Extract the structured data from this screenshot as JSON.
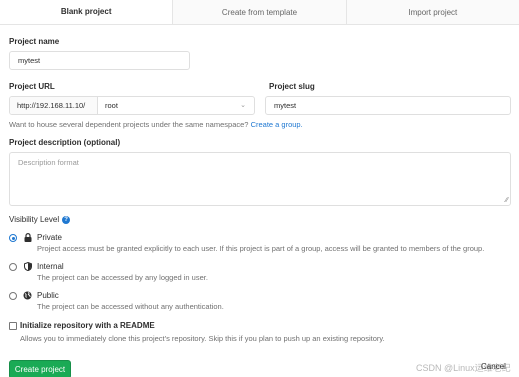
{
  "tabs": [
    {
      "label": "Blank project",
      "active": true
    },
    {
      "label": "Create from template",
      "active": false
    },
    {
      "label": "Import project",
      "active": false
    }
  ],
  "project_name": {
    "label": "Project name",
    "value": "mytest"
  },
  "project_url": {
    "label": "Project URL",
    "prefix": "http://192.168.11.10/",
    "namespace": "root"
  },
  "project_slug": {
    "label": "Project slug",
    "value": "mytest"
  },
  "namespace_help": {
    "text": "Want to house several dependent projects under the same namespace?",
    "link": "Create a group."
  },
  "description": {
    "label": "Project description (optional)",
    "placeholder": "Description format"
  },
  "visibility": {
    "label": "Visibility Level",
    "help_icon": "question-circle-icon",
    "options": [
      {
        "title": "Private",
        "icon": "lock-icon",
        "selected": true,
        "desc": "Project access must be granted explicitly to each user. If this project is part of a group, access will be granted to members of the group."
      },
      {
        "title": "Internal",
        "icon": "shield-icon",
        "selected": false,
        "desc": "The project can be accessed by any logged in user."
      },
      {
        "title": "Public",
        "icon": "globe-icon",
        "selected": false,
        "desc": "The project can be accessed without any authentication."
      }
    ]
  },
  "init_readme": {
    "label": "Initialize repository with a README",
    "desc": "Allows you to immediately clone this project's repository. Skip this if you plan to push up an existing repository.",
    "checked": false
  },
  "actions": {
    "create": "Create project",
    "cancel": "Cancel"
  },
  "watermark": "CSDN @Linux运维老纪",
  "colors": {
    "accent": "#1f78d1",
    "create_button": "#1aaa55"
  }
}
